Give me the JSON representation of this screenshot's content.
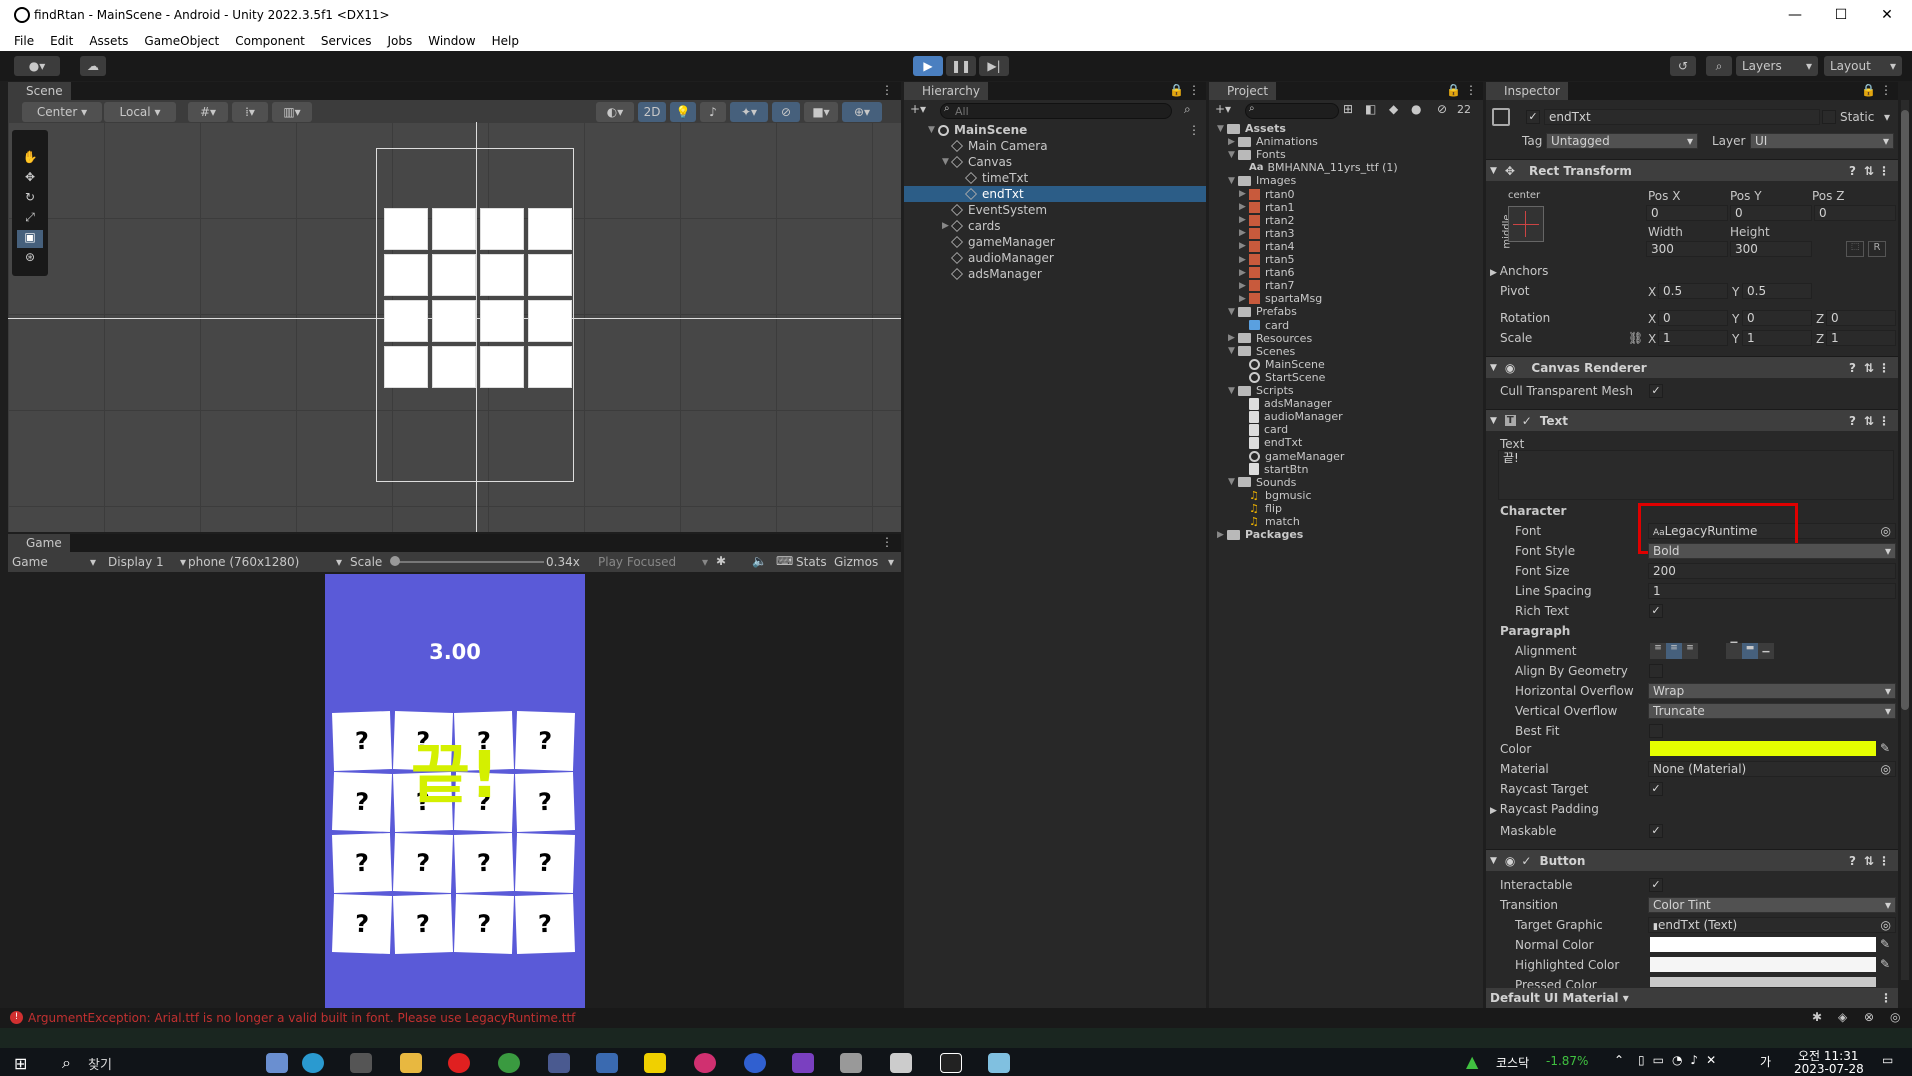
{
  "window": {
    "title": "findRtan - MainScene - Android - Unity 2022.3.5f1 <DX11>"
  },
  "menu": [
    "File",
    "Edit",
    "Assets",
    "GameObject",
    "Component",
    "Services",
    "Jobs",
    "Window",
    "Help"
  ],
  "toolbar": {
    "layers": "Layers",
    "layout": "Layout"
  },
  "scene": {
    "tab": "Scene",
    "pivot": "Center",
    "space": "Local",
    "mode2d": "2D"
  },
  "game": {
    "tab": "Game",
    "view": "Game",
    "display": "Display 1",
    "resolution": "phone (760x1280)",
    "scale_label": "Scale",
    "scale_value": "0.34x",
    "play_focused": "Play Focused",
    "stats": "Stats",
    "gizmos": "Gizmos",
    "timer": "3.00",
    "end_text": "끝!",
    "card_text": "?",
    "bg_color": "#5a5ad8",
    "end_color": "#d4f000"
  },
  "hierarchy": {
    "tab": "Hierarchy",
    "search_placeholder": "All",
    "items": [
      {
        "label": "MainScene",
        "depth": 0
      },
      {
        "label": "Main Camera",
        "depth": 1
      },
      {
        "label": "Canvas",
        "depth": 1
      },
      {
        "label": "timeTxt",
        "depth": 2
      },
      {
        "label": "endTxt",
        "depth": 2
      },
      {
        "label": "EventSystem",
        "depth": 1
      },
      {
        "label": "cards",
        "depth": 1
      },
      {
        "label": "gameManager",
        "depth": 1
      },
      {
        "label": "audioManager",
        "depth": 1
      },
      {
        "label": "adsManager",
        "depth": 1
      }
    ]
  },
  "project": {
    "tab": "Project",
    "count": "22",
    "items": [
      {
        "label": "Assets",
        "depth": 0,
        "icon": "folder-icon"
      },
      {
        "label": "Animations",
        "depth": 1,
        "icon": "folder-icon"
      },
      {
        "label": "Fonts",
        "depth": 1,
        "icon": "folder-icon"
      },
      {
        "label": "BMHANNA_11yrs_ttf (1)",
        "depth": 2,
        "icon": "font-icon"
      },
      {
        "label": "Images",
        "depth": 1,
        "icon": "folder-icon"
      },
      {
        "label": "rtan0",
        "depth": 2,
        "icon": "image-icon"
      },
      {
        "label": "rtan1",
        "depth": 2,
        "icon": "image-icon"
      },
      {
        "label": "rtan2",
        "depth": 2,
        "icon": "image-icon"
      },
      {
        "label": "rtan3",
        "depth": 2,
        "icon": "image-icon"
      },
      {
        "label": "rtan4",
        "depth": 2,
        "icon": "image-icon"
      },
      {
        "label": "rtan5",
        "depth": 2,
        "icon": "image-icon"
      },
      {
        "label": "rtan6",
        "depth": 2,
        "icon": "image-icon"
      },
      {
        "label": "rtan7",
        "depth": 2,
        "icon": "image-icon"
      },
      {
        "label": "spartaMsg",
        "depth": 2,
        "icon": "image-icon"
      },
      {
        "label": "Prefabs",
        "depth": 1,
        "icon": "folder-icon"
      },
      {
        "label": "card",
        "depth": 2,
        "icon": "prefab-icon"
      },
      {
        "label": "Resources",
        "depth": 1,
        "icon": "folder-icon"
      },
      {
        "label": "Scenes",
        "depth": 1,
        "icon": "folder-icon"
      },
      {
        "label": "MainScene",
        "depth": 2,
        "icon": "scene-icon"
      },
      {
        "label": "StartScene",
        "depth": 2,
        "icon": "scene-icon"
      },
      {
        "label": "Scripts",
        "depth": 1,
        "icon": "folder-icon"
      },
      {
        "label": "adsManager",
        "depth": 2,
        "icon": "script-icon"
      },
      {
        "label": "audioManager",
        "depth": 2,
        "icon": "script-icon"
      },
      {
        "label": "card",
        "depth": 2,
        "icon": "script-icon"
      },
      {
        "label": "endTxt",
        "depth": 2,
        "icon": "script-icon"
      },
      {
        "label": "gameManager",
        "depth": 2,
        "icon": "gear-icon"
      },
      {
        "label": "startBtn",
        "depth": 2,
        "icon": "script-icon"
      },
      {
        "label": "Sounds",
        "depth": 1,
        "icon": "folder-icon"
      },
      {
        "label": "bgmusic",
        "depth": 2,
        "icon": "audio-icon"
      },
      {
        "label": "flip",
        "depth": 2,
        "icon": "audio-icon"
      },
      {
        "label": "match",
        "depth": 2,
        "icon": "audio-icon"
      },
      {
        "label": "Packages",
        "depth": 0,
        "icon": "folder-icon"
      }
    ]
  },
  "inspector": {
    "tab": "Inspector",
    "object_name": "endTxt",
    "static_label": "Static",
    "tag_label": "Tag",
    "tag_value": "Untagged",
    "layer_label": "Layer",
    "layer_value": "UI",
    "rect_transform": {
      "title": "Rect Transform",
      "anchor_h": "center",
      "anchor_v": "middle",
      "posx_label": "Pos X",
      "posx": "0",
      "posy_label": "Pos Y",
      "posy": "0",
      "posz_label": "Pos Z",
      "posz": "0",
      "width_label": "Width",
      "width": "300",
      "height_label": "Height",
      "height": "300",
      "anchors_label": "Anchors",
      "pivot_label": "Pivot",
      "pivot_x": "0.5",
      "pivot_y": "0.5",
      "rotation_label": "Rotation",
      "rot_x": "0",
      "rot_y": "0",
      "rot_z": "0",
      "scale_label": "Scale",
      "scale_x": "1",
      "scale_y": "1",
      "scale_z": "1",
      "x": "X",
      "y": "Y",
      "z": "Z",
      "r": "R"
    },
    "canvas_renderer": {
      "title": "Canvas Renderer",
      "cull_label": "Cull Transparent Mesh"
    },
    "text": {
      "title": "Text",
      "text_label": "Text",
      "text_value": "끝!",
      "character_label": "Character",
      "font_label": "Font",
      "font_value": "LegacyRuntime",
      "font_style_label": "Font Style",
      "font_style_value": "Bold",
      "font_size_label": "Font Size",
      "font_size_value": "200",
      "line_spacing_label": "Line Spacing",
      "line_spacing_value": "1",
      "rich_text_label": "Rich Text",
      "paragraph_label": "Paragraph",
      "alignment_label": "Alignment",
      "align_geometry_label": "Align By Geometry",
      "h_overflow_label": "Horizontal Overflow",
      "h_overflow_value": "Wrap",
      "v_overflow_label": "Vertical Overflow",
      "v_overflow_value": "Truncate",
      "best_fit_label": "Best Fit",
      "color_label": "Color",
      "color_value": "#e6ff00",
      "material_label": "Material",
      "material_value": "None (Material)",
      "raycast_target_label": "Raycast Target",
      "raycast_padding_label": "Raycast Padding",
      "maskable_label": "Maskable"
    },
    "button": {
      "title": "Button",
      "interactable_label": "Interactable",
      "transition_label": "Transition",
      "transition_value": "Color Tint",
      "target_graphic_label": "Target Graphic",
      "target_graphic_value": "endTxt (Text)",
      "normal_color_label": "Normal Color",
      "highlighted_color_label": "Highlighted Color",
      "pressed_color_label": "Pressed Color"
    },
    "footer": "Default UI Material"
  },
  "console": {
    "error": "ArgumentException: Arial.ttf is no longer a valid built in font. Please use LegacyRuntime.ttf"
  },
  "taskbar": {
    "search": "찾기",
    "stock_name": "코스닥",
    "stock_change": "-1.87%",
    "time": "오전 11:31",
    "date": "2023-07-28"
  }
}
